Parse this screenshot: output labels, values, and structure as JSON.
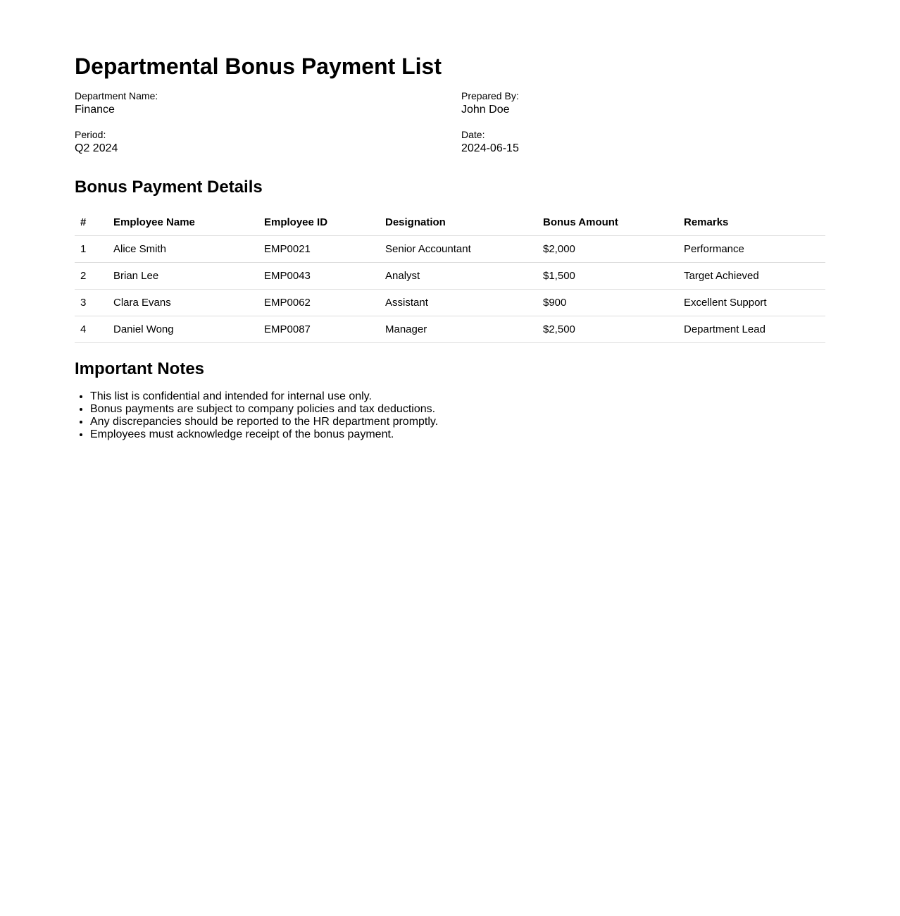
{
  "document": {
    "title": "Departmental Bonus Payment List"
  },
  "meta": {
    "department_label": "Department Name:",
    "department_value": "Finance",
    "prepared_label": "Prepared By:",
    "prepared_value": "John Doe",
    "period_label": "Period:",
    "period_value": "Q2 2024",
    "date_label": "Date:",
    "date_value": "2024-06-15"
  },
  "details": {
    "title": "Bonus Payment Details",
    "columns": [
      "#",
      "Employee Name",
      "Employee ID",
      "Designation",
      "Bonus Amount",
      "Remarks"
    ],
    "rows": [
      [
        "1",
        "Alice Smith",
        "EMP0021",
        "Senior Accountant",
        "$2,000",
        "Performance"
      ],
      [
        "2",
        "Brian Lee",
        "EMP0043",
        "Analyst",
        "$1,500",
        "Target Achieved"
      ],
      [
        "3",
        "Clara Evans",
        "EMP0062",
        "Assistant",
        "$900",
        "Excellent Support"
      ],
      [
        "4",
        "Daniel Wong",
        "EMP0087",
        "Manager",
        "$2,500",
        "Department Lead"
      ]
    ]
  },
  "notes": {
    "title": "Important Notes",
    "items": [
      "This list is confidential and intended for internal use only.",
      "Bonus payments are subject to company policies and tax deductions.",
      "Any discrepancies should be reported to the HR department promptly.",
      "Employees must acknowledge receipt of the bonus payment."
    ]
  }
}
